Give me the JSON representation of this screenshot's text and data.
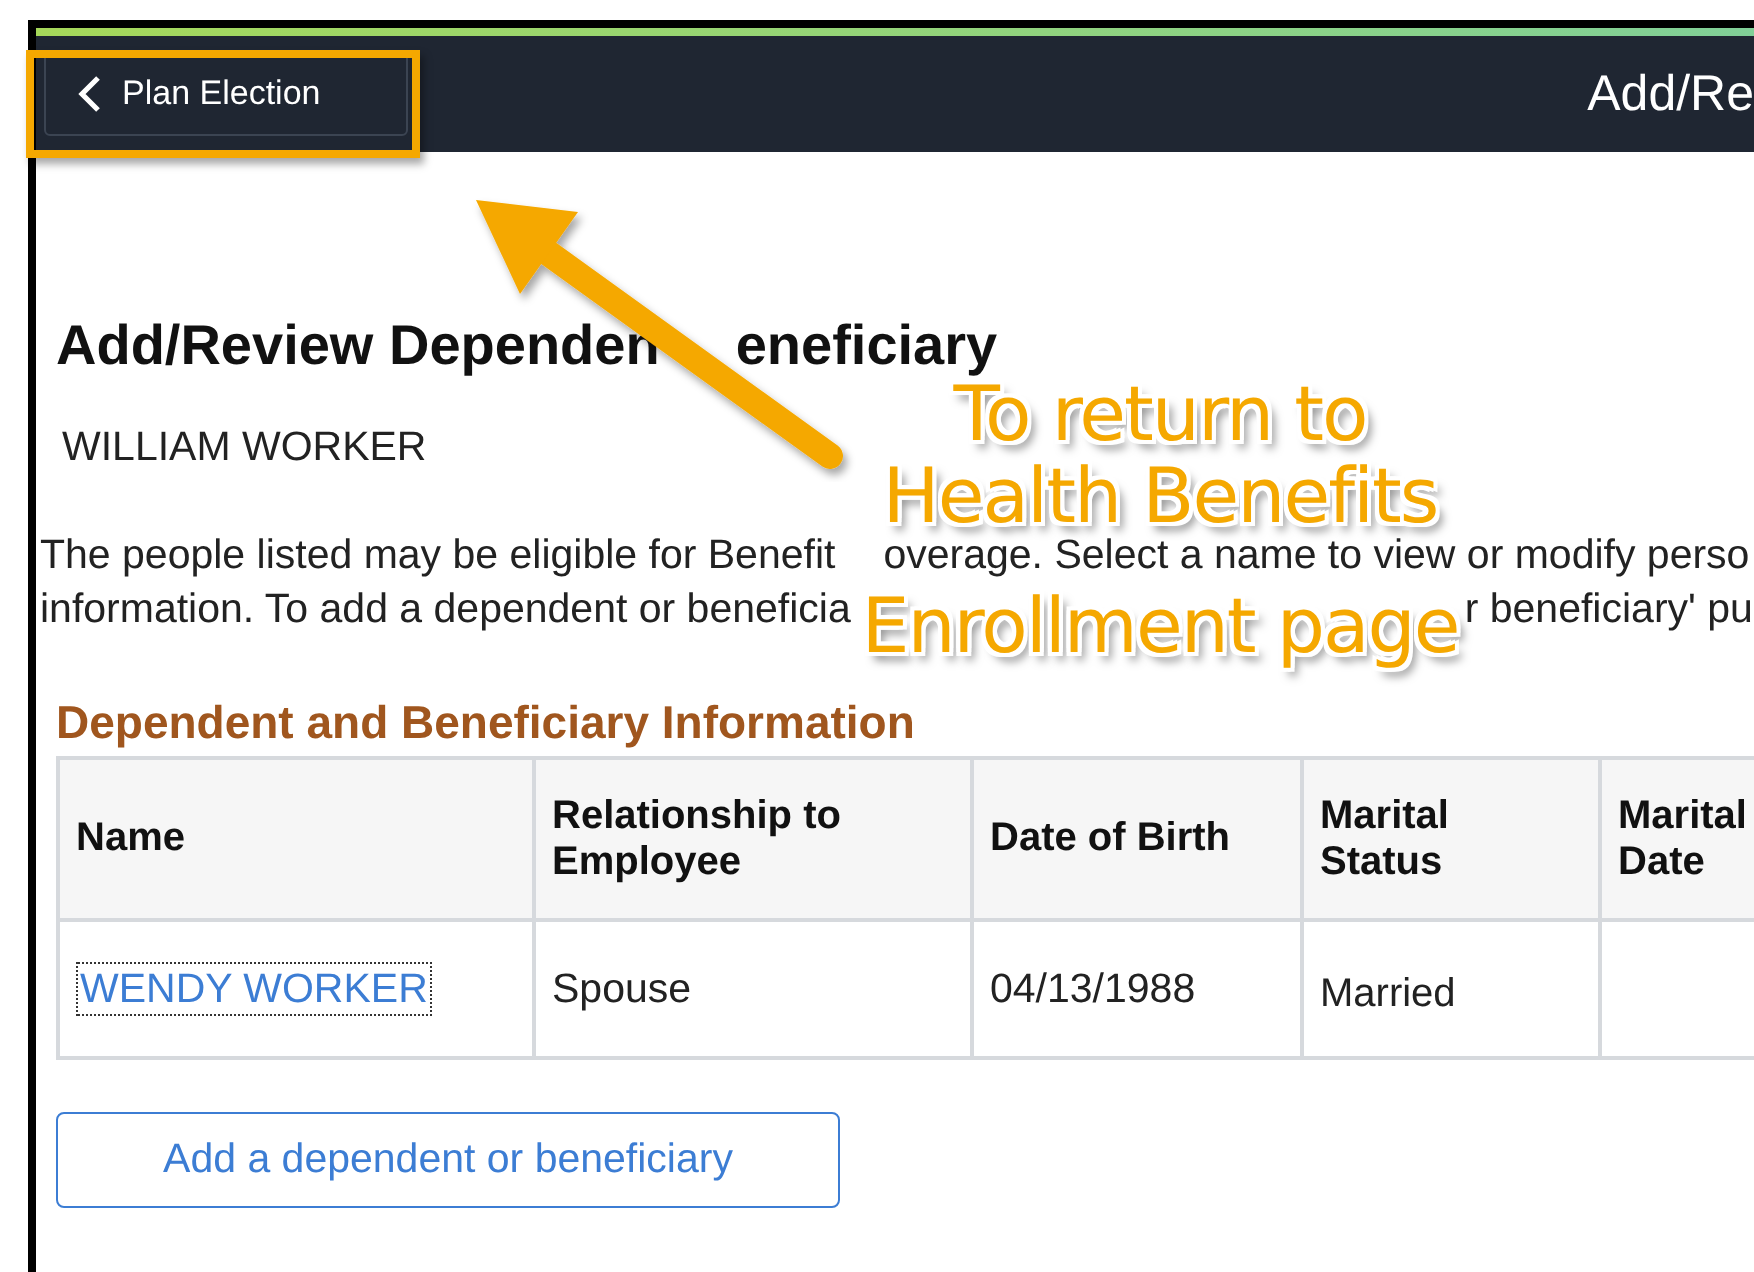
{
  "header": {
    "back_button": "Plan Election",
    "title": "Add/Re"
  },
  "page": {
    "title_parts": [
      "Add/Review Dependen",
      "eneficiary"
    ],
    "employee": "WILLIAM WORKER",
    "intro_lines": [
      [
        "The people listed may be eligible for Benefit",
        "overage. Select a name to view or modify perso"
      ],
      [
        "information. To add a dependent or beneficia",
        "r beneficiary' pu"
      ]
    ]
  },
  "table": {
    "title": "Dependent and Beneficiary Information",
    "columns": [
      "Name",
      "Relationship to Employee",
      "Date of Birth",
      "Marital Status",
      "Marital Date"
    ],
    "rows": [
      {
        "focused": true,
        "cells": [
          "WENDY WORKER",
          "Spouse",
          "04/13/1988",
          "Married"
        ]
      }
    ]
  },
  "add_button": "Add a dependent or beneficiary",
  "annotation": {
    "callout_lines": [
      "To return to",
      "Health Benefits",
      "Enrollment page"
    ]
  }
}
